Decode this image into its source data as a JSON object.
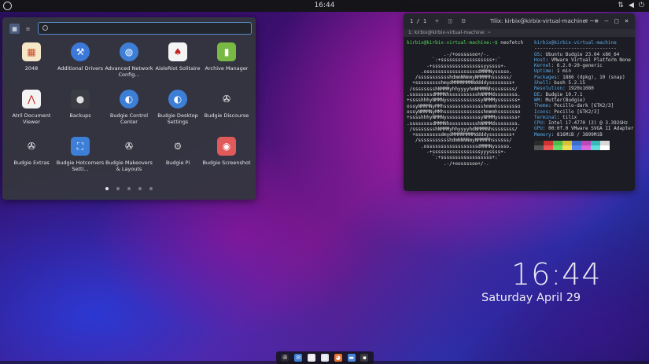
{
  "topbar": {
    "clock": "16:44"
  },
  "appmenu": {
    "search_placeholder": "",
    "apps": [
      {
        "label": "2048",
        "icon": "2048-tile-icon",
        "color": "#f5e8c8",
        "glyph": "▦",
        "gcolor": "#d04a2a"
      },
      {
        "label": "Additional Drivers",
        "icon": "driver-wrench-icon",
        "color": "#3b78d8",
        "glyph": "⚒",
        "round": true
      },
      {
        "label": "Advanced Network Config...",
        "icon": "network-globe-icon",
        "color": "#3d7fd6",
        "glyph": "◍",
        "round": true
      },
      {
        "label": "AisleRiot Solitaire",
        "icon": "playing-cards-icon",
        "color": "#f4f4f4",
        "glyph": "♠",
        "gcolor": "#c02020"
      },
      {
        "label": "Archive Manager",
        "icon": "archive-zip-icon",
        "color": "#77b943",
        "glyph": "▮"
      },
      {
        "label": "Atril Document Viewer",
        "icon": "pdf-document-icon",
        "color": "#f3f3f3",
        "glyph": "⋀",
        "gcolor": "#d02020"
      },
      {
        "label": "Backups",
        "icon": "backup-safe-icon",
        "color": "#3a3c44",
        "glyph": "●",
        "gcolor": "#e0e0e0"
      },
      {
        "label": "Budgie Control Center",
        "icon": "toggle-switch-icon",
        "color": "#3d7fd6",
        "glyph": "◐",
        "round": true
      },
      {
        "label": "Budgie Desktop Settings",
        "icon": "toggle-switch-icon",
        "color": "#3d7fd6",
        "glyph": "◐",
        "round": true
      },
      {
        "label": "Budgie Discourse",
        "icon": "budgie-logo-icon",
        "color": "transparent",
        "glyph": "✇"
      },
      {
        "label": "Budgie Extras",
        "icon": "budgie-logo-icon",
        "color": "transparent",
        "glyph": "✇"
      },
      {
        "label": "Budgie Hotcorners Setti...",
        "icon": "corners-frame-icon",
        "color": "#3d7fd6",
        "glyph": "⛶"
      },
      {
        "label": "Budgie Makeovers & Layouts",
        "icon": "budgie-logo-icon",
        "color": "transparent",
        "glyph": "✇"
      },
      {
        "label": "Budgie Pi",
        "icon": "gear-icon",
        "color": "transparent",
        "glyph": "⚙",
        "gcolor": "#d0d0d0"
      },
      {
        "label": "Budgie Screenshot",
        "icon": "camera-icon",
        "color": "#e05a5a",
        "glyph": "◉"
      }
    ],
    "pages": 5,
    "active_page": 0
  },
  "terminal": {
    "tab_count": "1 / 1",
    "title": "Tilix: kirbix@kirbix-virtual-machine: ~",
    "subtitle": "1: kirbix@kirbix-virtual-machine: ~",
    "prompt": "kirbix@kirbix-virtual-machine:~$",
    "command": " neofetch",
    "ascii_art": [
      "             .-/+oossssoo+/-.",
      "         `:+ssssssssssssssssss+:`",
      "       -+ssssssssssssssssssyyssss+-",
      "     .ossssssssssssssssssdMMMNysssso.",
      "   /ssssssssssshdmmNNmmyNMMMMhssssss/",
      "  +ssssssssshmydMMMMMMMNddddyssssssss+",
      " /sssssssshNMMMyhhyyyyhmNMMMNhssssssss/",
      ".ssssssssdMMMNhsssssssssshNMMMdssssssss.",
      "+sssshhhyNMMNyssssssssssssyNMMMysssssss+",
      "ossyNMMMNyMMhsssssssssssssshmmmhssssssso",
      "ossyNMMMNyMMhsssssssssssssshmmmhssssssso",
      "+sssshhhyNMMNyssssssssssssyNMMMysssssss+",
      ".ssssssssdMMMNhsssssssssshNMMMdssssssss.",
      " /sssssssshNMMMyhhyyyyhdNMMMNhssssssss/",
      "  +sssssssssdmydMMMMMMMMddddyssssssss+",
      "   /ssssssssssshdmNNNNmyNMMMMhssssss/",
      "     .ossssssssssssssssssdMMMNysssso.",
      "       -+sssssssssssssssssyyyssss+-",
      "         `:+ssssssssssssssssss+:`",
      "             .-/+oossssoo+/-."
    ],
    "user_host": "kirbix@kirbix-virtual-machine",
    "separator": "-----------------------------",
    "info": [
      {
        "key": "OS",
        "value": "Ubuntu Budgie 23.04 x86_64"
      },
      {
        "key": "Host",
        "value": "VMware Virtual Platform None"
      },
      {
        "key": "Kernel",
        "value": "6.2.0-20-generic"
      },
      {
        "key": "Uptime",
        "value": "1 min"
      },
      {
        "key": "Packages",
        "value": "1886 (dpkg), 10 (snap)"
      },
      {
        "key": "Shell",
        "value": "bash 5.2.15"
      },
      {
        "key": "Resolution",
        "value": "1920x1080"
      },
      {
        "key": "DE",
        "value": "Budgie 10.7.1"
      },
      {
        "key": "WM",
        "value": "Mutter(Budgie)"
      },
      {
        "key": "Theme",
        "value": "Pocillo-dark [GTK2/3]"
      },
      {
        "key": "Icons",
        "value": "Pocillo [GTK2/3]"
      },
      {
        "key": "Terminal",
        "value": "tilix"
      },
      {
        "key": "CPU",
        "value": "Intel i7-4770 (2) @ 3.392GHz"
      },
      {
        "key": "GPU",
        "value": "00:0f.0 VMware SVGA II Adapter"
      },
      {
        "key": "Memory",
        "value": "816MiB / 3899MiB"
      }
    ],
    "swatches_top": [
      "#2b2b2b",
      "#cc3333",
      "#4bbd4b",
      "#d8c23a",
      "#3c6fcc",
      "#b84bb8",
      "#3cb8b8",
      "#d8d8d8"
    ],
    "swatches_bottom": [
      "#555555",
      "#ee5555",
      "#66dd66",
      "#eedd55",
      "#5588ee",
      "#dd66dd",
      "#66dddd",
      "#ffffff"
    ]
  },
  "desktop": {
    "time": "16:44",
    "date": "Saturday April 29"
  },
  "dock": {
    "items": [
      {
        "name": "budgie-menu-icon",
        "color": "#2a2a30",
        "glyph": "✇"
      },
      {
        "name": "mail-icon",
        "color": "#3d7fd6",
        "glyph": "✉"
      },
      {
        "name": "files-icon",
        "color": "#e8e8ec",
        "glyph": "▤"
      },
      {
        "name": "document-icon",
        "color": "#dfe3ea",
        "glyph": "▥"
      },
      {
        "name": "firefox-icon",
        "color": "#e8732a",
        "glyph": "◕"
      },
      {
        "name": "folder-icon",
        "color": "#4a86d8",
        "glyph": "▬"
      },
      {
        "name": "terminal-icon",
        "color": "#3a3a40",
        "glyph": "▪"
      }
    ]
  }
}
